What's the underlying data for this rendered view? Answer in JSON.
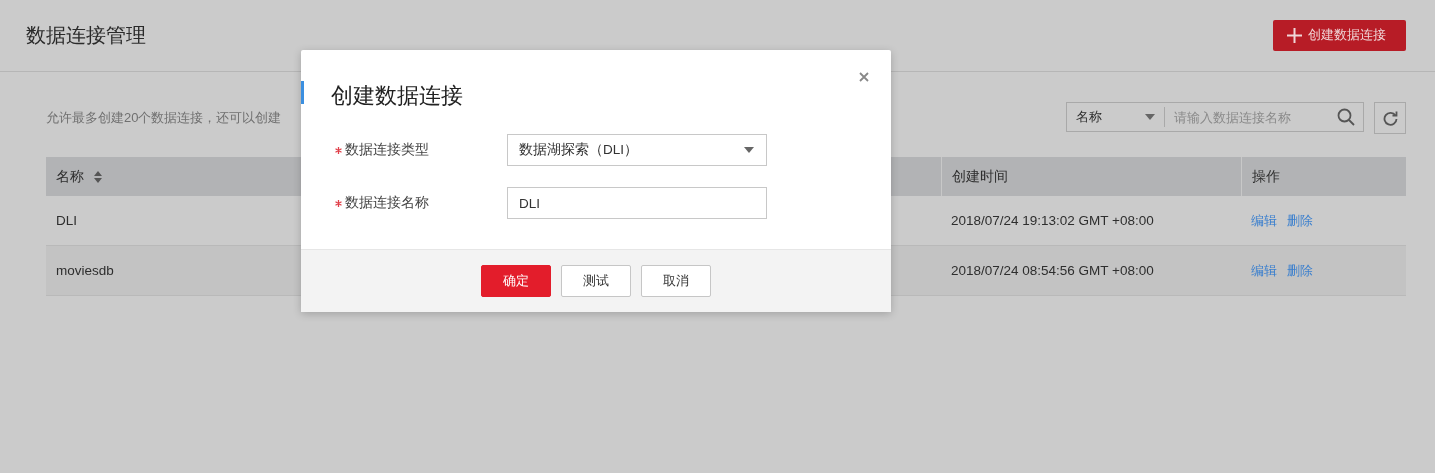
{
  "page": {
    "title": "数据连接管理",
    "create_button": "创建数据连接"
  },
  "hint": "允许最多创建20个数据连接，还可以创建",
  "search": {
    "filter": "名称",
    "placeholder": "请输入数据连接名称"
  },
  "table": {
    "columns": [
      {
        "label": "名称",
        "sortable": true
      },
      {
        "label": "创建时间",
        "sortable": false
      },
      {
        "label": "操作",
        "sortable": false
      }
    ],
    "rows": [
      {
        "name": "DLI",
        "created": "2018/07/24 19:13:02 GMT +08:00",
        "actions": [
          "编辑",
          "删除"
        ]
      },
      {
        "name": "moviesdb",
        "created": "2018/07/24 08:54:56 GMT +08:00",
        "actions": [
          "编辑",
          "删除"
        ]
      }
    ]
  },
  "dialog": {
    "title": "创建数据连接",
    "fields": [
      {
        "kind": "select",
        "label": "数据连接类型",
        "required": true,
        "value": "数据湖探索（DLI）"
      },
      {
        "kind": "input",
        "label": "数据连接名称",
        "required": true,
        "value": "DLI"
      }
    ],
    "buttons": [
      {
        "label": "确定",
        "primary": true
      },
      {
        "label": "测试",
        "primary": false
      },
      {
        "label": "取消",
        "primary": false
      }
    ]
  }
}
